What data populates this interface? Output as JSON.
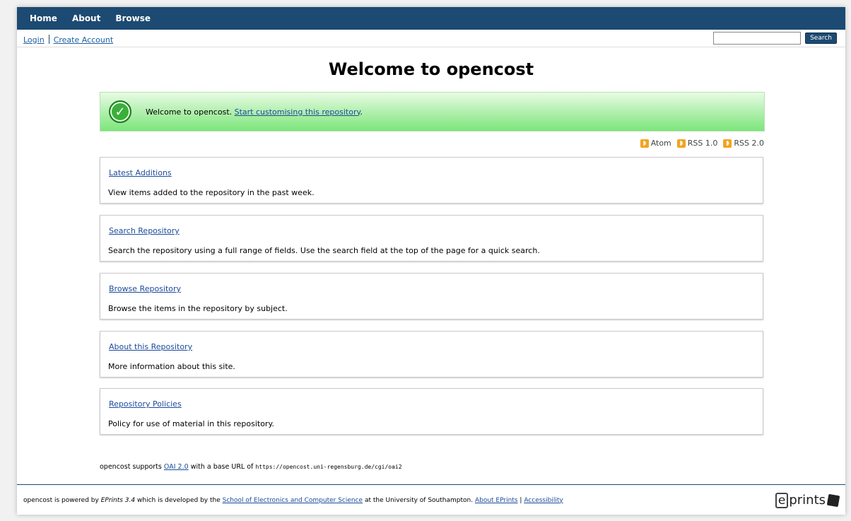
{
  "nav": {
    "items": [
      "Home",
      "About",
      "Browse"
    ]
  },
  "subbar": {
    "login": "Login",
    "create_account": "Create Account",
    "search_value": "",
    "search_button": "Search"
  },
  "main": {
    "title": "Welcome to opencost",
    "banner": {
      "text": "Welcome to opencost.",
      "link": "Start customising this repository",
      "after": "."
    },
    "feeds": [
      "Atom",
      "RSS 1.0",
      "RSS 2.0"
    ],
    "cards": [
      {
        "link": "Latest Additions",
        "desc": "View items added to the repository in the past week."
      },
      {
        "link": "Search Repository",
        "desc": "Search the repository using a full range of fields. Use the search field at the top of the page for a quick search."
      },
      {
        "link": "Browse Repository",
        "desc": "Browse the items in the repository by subject."
      },
      {
        "link": "About this Repository",
        "desc": "More information about this site."
      },
      {
        "link": "Repository Policies",
        "desc": "Policy for use of material in this repository."
      }
    ],
    "oai": {
      "prefix": "opencost supports",
      "link": "OAI 2.0",
      "middle": "with a base URL of",
      "url": "https://opencost.uni-regensburg.de/cgi/oai2"
    }
  },
  "footer": {
    "t1": "opencost is powered by",
    "eprints_version": "EPrints 3.4",
    "t2": "which is developed by the",
    "school_link": "School of Electronics and Computer Science",
    "t3": "at the University of Southampton.",
    "about_link": "About EPrints",
    "sep": "|",
    "accessibility_link": "Accessibility",
    "logo_text_e": "e",
    "logo_text_rest": "prints"
  },
  "colors": {
    "nav_bg": "#1d4a72",
    "banner_green": "#7ce57a",
    "link": "#1b4b9b",
    "rss": "#f6a21e"
  }
}
